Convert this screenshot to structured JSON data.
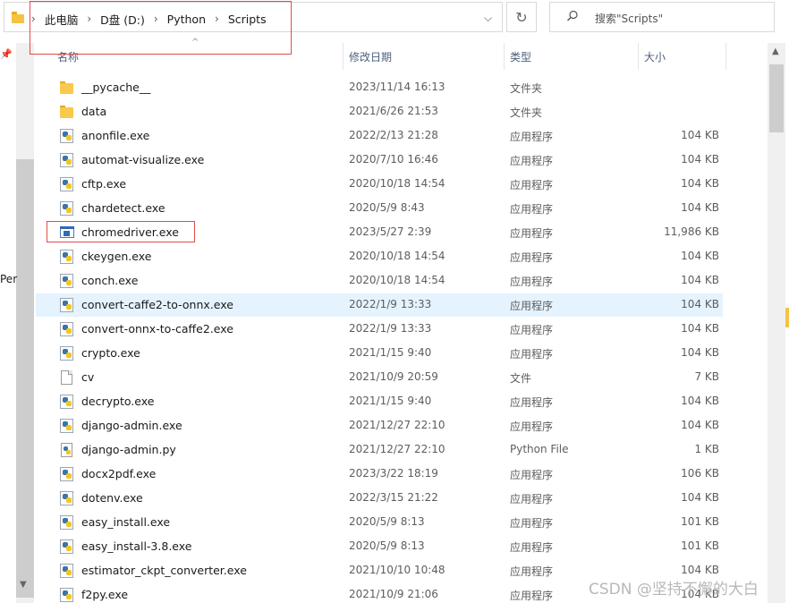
{
  "address_bar": {
    "breadcrumbs": [
      "此电脑",
      "D盘 (D:)",
      "Python",
      "Scripts"
    ],
    "search_placeholder": "搜索\"Scripts\""
  },
  "nav": {
    "partial_label": "Per"
  },
  "columns": {
    "name": "名称",
    "date": "修改日期",
    "type": "类型",
    "size": "大小"
  },
  "files": [
    {
      "name": "__pycache__",
      "date": "2023/11/14 16:13",
      "type": "文件夹",
      "size": "",
      "icon": "folder-icon"
    },
    {
      "name": "data",
      "date": "2021/6/26 21:53",
      "type": "文件夹",
      "size": "",
      "icon": "folder-icon"
    },
    {
      "name": "anonfile.exe",
      "date": "2022/2/13 21:28",
      "type": "应用程序",
      "size": "104 KB",
      "icon": "python-exe-icon"
    },
    {
      "name": "automat-visualize.exe",
      "date": "2020/7/10 16:46",
      "type": "应用程序",
      "size": "104 KB",
      "icon": "python-exe-icon"
    },
    {
      "name": "cftp.exe",
      "date": "2020/10/18 14:54",
      "type": "应用程序",
      "size": "104 KB",
      "icon": "python-exe-icon"
    },
    {
      "name": "chardetect.exe",
      "date": "2020/5/9 8:43",
      "type": "应用程序",
      "size": "104 KB",
      "icon": "python-exe-icon"
    },
    {
      "name": "chromedriver.exe",
      "date": "2023/5/27 2:39",
      "type": "应用程序",
      "size": "11,986 KB",
      "icon": "window-exe-icon"
    },
    {
      "name": "ckeygen.exe",
      "date": "2020/10/18 14:54",
      "type": "应用程序",
      "size": "104 KB",
      "icon": "python-exe-icon"
    },
    {
      "name": "conch.exe",
      "date": "2020/10/18 14:54",
      "type": "应用程序",
      "size": "104 KB",
      "icon": "python-exe-icon"
    },
    {
      "name": "convert-caffe2-to-onnx.exe",
      "date": "2022/1/9 13:33",
      "type": "应用程序",
      "size": "104 KB",
      "icon": "python-exe-icon"
    },
    {
      "name": "convert-onnx-to-caffe2.exe",
      "date": "2022/1/9 13:33",
      "type": "应用程序",
      "size": "104 KB",
      "icon": "python-exe-icon"
    },
    {
      "name": "crypto.exe",
      "date": "2021/1/15 9:40",
      "type": "应用程序",
      "size": "104 KB",
      "icon": "python-exe-icon"
    },
    {
      "name": "cv",
      "date": "2021/10/9 20:59",
      "type": "文件",
      "size": "7 KB",
      "icon": "blank-file-icon"
    },
    {
      "name": "decrypto.exe",
      "date": "2021/1/15 9:40",
      "type": "应用程序",
      "size": "104 KB",
      "icon": "python-exe-icon"
    },
    {
      "name": "django-admin.exe",
      "date": "2021/12/27 22:10",
      "type": "应用程序",
      "size": "104 KB",
      "icon": "python-exe-icon"
    },
    {
      "name": "django-admin.py",
      "date": "2021/12/27 22:10",
      "type": "Python File",
      "size": "1 KB",
      "icon": "python-file-icon"
    },
    {
      "name": "docx2pdf.exe",
      "date": "2023/3/22 18:19",
      "type": "应用程序",
      "size": "106 KB",
      "icon": "python-exe-icon"
    },
    {
      "name": "dotenv.exe",
      "date": "2022/3/15 21:22",
      "type": "应用程序",
      "size": "104 KB",
      "icon": "python-exe-icon"
    },
    {
      "name": "easy_install.exe",
      "date": "2020/5/9 8:13",
      "type": "应用程序",
      "size": "101 KB",
      "icon": "python-exe-icon"
    },
    {
      "name": "easy_install-3.8.exe",
      "date": "2020/5/9 8:13",
      "type": "应用程序",
      "size": "101 KB",
      "icon": "python-exe-icon"
    },
    {
      "name": "estimator_ckpt_converter.exe",
      "date": "2021/10/10 10:48",
      "type": "应用程序",
      "size": "104 KB",
      "icon": "python-exe-icon"
    },
    {
      "name": "f2py.exe",
      "date": "2021/10/9 21:06",
      "type": "应用程序",
      "size": "104 KB",
      "icon": "python-exe-icon"
    }
  ],
  "hovered_file": "convert-caffe2-to-onnx.exe",
  "highlighted_file": "chromedriver.exe",
  "watermark": "CSDN @坚持不懈的大白",
  "colors": {
    "annotation_red": "#e24b4b",
    "hover_bg": "#e5f3ff",
    "header_text": "#4c607a"
  }
}
